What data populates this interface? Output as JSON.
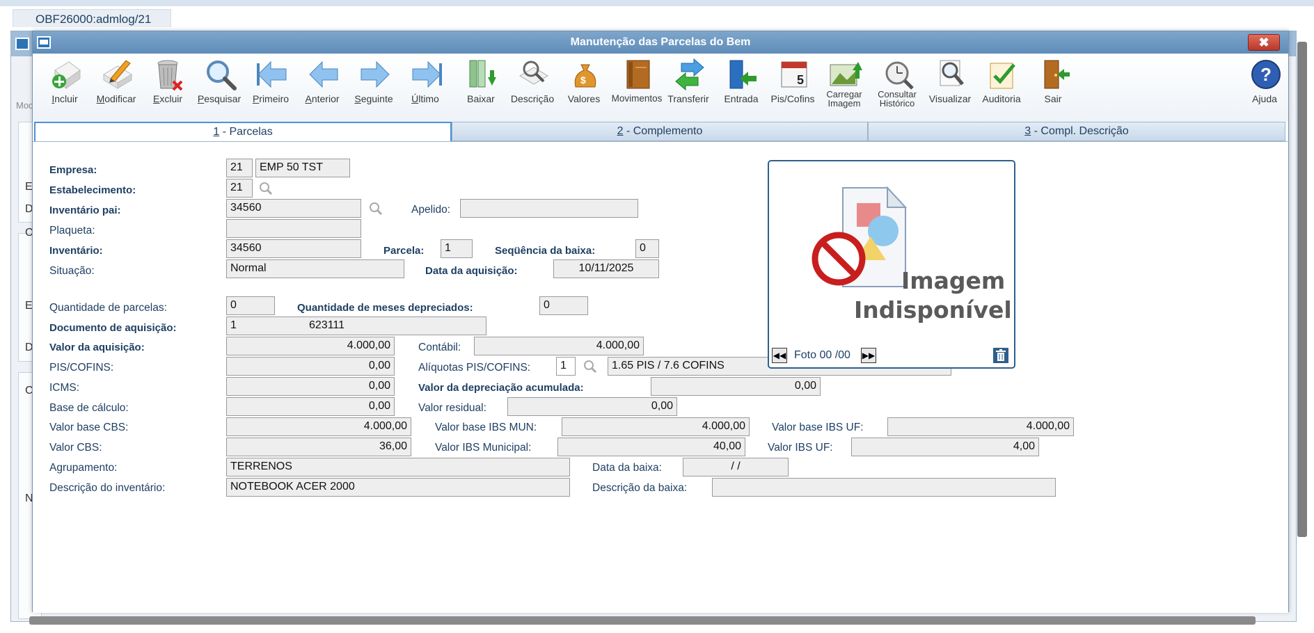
{
  "outer_tab": {
    "label": "OBF26000:admlog/21"
  },
  "background_window": {
    "letters": [
      "E",
      "D",
      "O",
      "E",
      "D",
      "C",
      "N"
    ],
    "toolbar_fragment": "Moc"
  },
  "dialog": {
    "title": "Manutenção das Parcelas do Bem",
    "close_symbol": "✖"
  },
  "toolbar": {
    "items": [
      {
        "label": "Incluir",
        "icon": "add-document-icon"
      },
      {
        "label": "Modificar",
        "icon": "edit-pencil-icon"
      },
      {
        "label": "Excluir",
        "icon": "trash-bin-icon"
      },
      {
        "label": "Pesquisar",
        "icon": "magnifier-icon"
      },
      {
        "label": "Primeiro",
        "icon": "first-arrow-icon"
      },
      {
        "label": "Anterior",
        "icon": "previous-arrow-icon"
      },
      {
        "label": "Seguinte",
        "icon": "next-arrow-icon"
      },
      {
        "label": "Último",
        "icon": "last-arrow-icon"
      },
      {
        "label": "Baixar",
        "icon": "download-books-icon"
      },
      {
        "label": "Descrição",
        "icon": "description-tools-icon"
      },
      {
        "label": "Valores",
        "icon": "money-bag-icon"
      },
      {
        "label": "Movimentos",
        "icon": "book-icon"
      },
      {
        "label": "Transferir",
        "icon": "transfer-arrows-icon"
      },
      {
        "label": "Entrada",
        "icon": "entry-icon"
      },
      {
        "label": "Pis/Cofins",
        "icon": "calendar-5-icon"
      },
      {
        "label": "Carregar Imagem",
        "icon": "load-image-icon"
      },
      {
        "label": "Consultar Histórico",
        "icon": "history-search-icon"
      },
      {
        "label": "Visualizar",
        "icon": "view-document-icon"
      },
      {
        "label": "Auditoria",
        "icon": "audit-check-icon"
      },
      {
        "label": "Sair",
        "icon": "exit-door-icon"
      },
      {
        "label": "Ajuda",
        "icon": "help-icon"
      }
    ]
  },
  "tabs": [
    {
      "accel": "1",
      "label": " - Parcelas"
    },
    {
      "accel": "2",
      "label": " - Complemento"
    },
    {
      "accel": "3",
      "label": " - Compl. Descrição"
    }
  ],
  "form": {
    "empresa": {
      "label": "Empresa:",
      "code": "21",
      "name": "EMP 50 TST"
    },
    "estabelecimento": {
      "label": "Estabelecimento:",
      "code": "21"
    },
    "inventario_pai": {
      "label": "Inventário pai:",
      "value": "34560"
    },
    "apelido": {
      "label": "Apelido:",
      "value": ""
    },
    "plaqueta": {
      "label": "Plaqueta:",
      "value": ""
    },
    "inventario": {
      "label": "Inventário:",
      "value": "34560"
    },
    "parcela": {
      "label": "Parcela:",
      "value": "1"
    },
    "sequencia_baixa": {
      "label": "Seqüência da baixa:",
      "value": "0"
    },
    "situacao": {
      "label": "Situação:",
      "value": "Normal"
    },
    "data_aquisicao": {
      "label": "Data da aquisição:",
      "value": "10/11/2025"
    },
    "qtd_parcelas": {
      "label": "Quantidade de parcelas:",
      "value": "0"
    },
    "qtd_meses_depreciados": {
      "label": "Quantidade de meses depreciados:",
      "value": "0"
    },
    "documento_aquisicao": {
      "label": "Documento de aquisição:",
      "value1": "1",
      "value2": "623111"
    },
    "valor_aquisicao": {
      "label": "Valor da aquisição:",
      "value": "4.000,00"
    },
    "contabil": {
      "label": "Contábil:",
      "value": "4.000,00"
    },
    "pis_cofins": {
      "label": "PIS/COFINS:",
      "value": "0,00"
    },
    "aliquotas_pis_cofins": {
      "label": "Alíquotas PIS/COFINS:",
      "code": "1",
      "desc": "1.65 PIS / 7.6 COFINS"
    },
    "icms": {
      "label": "ICMS:",
      "value": "0,00"
    },
    "valor_depreciacao_acumulada": {
      "label": "Valor da depreciação acumulada:",
      "value": "0,00"
    },
    "base_calculo": {
      "label": "Base de cálculo:",
      "value": "0,00"
    },
    "valor_residual": {
      "label": "Valor residual:",
      "value": "0,00"
    },
    "valor_base_cbs": {
      "label": "Valor base CBS:",
      "value": "4.000,00"
    },
    "valor_base_ibs_mun": {
      "label": "Valor base IBS MUN:",
      "value": "4.000,00"
    },
    "valor_base_ibs_uf": {
      "label": "Valor base IBS UF:",
      "value": "4.000,00"
    },
    "valor_cbs": {
      "label": "Valor CBS:",
      "value": "36,00"
    },
    "valor_ibs_municipal": {
      "label": "Valor IBS Municipal:",
      "value": "40,00"
    },
    "valor_ibs_uf": {
      "label": "Valor IBS UF:",
      "value": "4,00"
    },
    "agrupamento": {
      "label": "Agrupamento:",
      "value": "TERRENOS"
    },
    "data_baixa": {
      "label": "Data da baixa:",
      "value": "/ /"
    },
    "descricao_inventario": {
      "label": "Descrição do inventário:",
      "value": "NOTEBOOK ACER 2000"
    },
    "descricao_baixa": {
      "label": "Descrição da baixa:",
      "value": ""
    }
  },
  "image_panel": {
    "placeholder_line1": "Imagem",
    "placeholder_line2": "Indisponível",
    "counter": "Foto 00 /00",
    "prev_symbol": "◀◀",
    "next_symbol": "▶▶"
  },
  "colors": {
    "label_blue": "#1f3f63",
    "title_bar": "#6b97c2",
    "close_red": "#c94434",
    "field_bg": "#eeeeee"
  }
}
